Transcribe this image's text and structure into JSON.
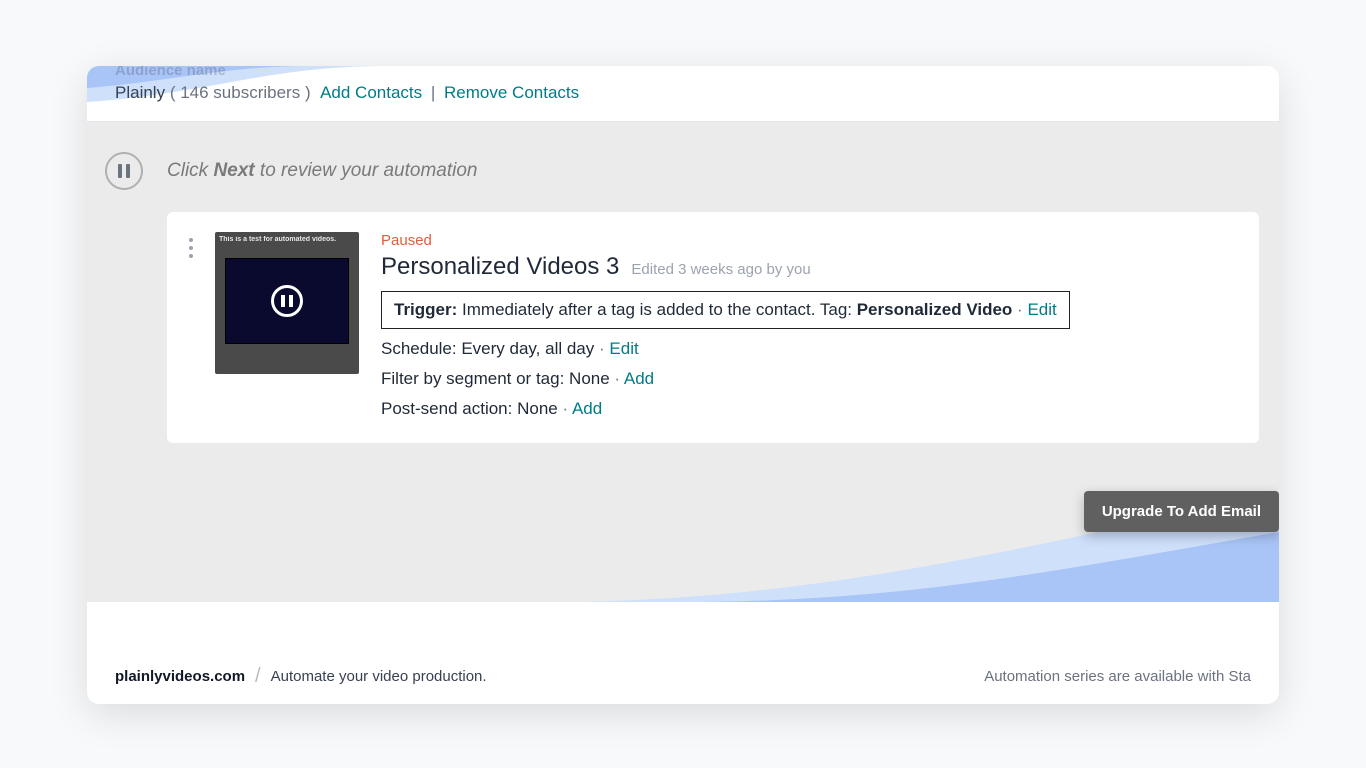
{
  "header": {
    "audience_label": "Audience name",
    "audience_name": "Plainly",
    "subscriber_count": "146 subscribers",
    "add_contacts": "Add Contacts",
    "remove_contacts": "Remove Contacts"
  },
  "instruction": {
    "prefix": "Click ",
    "bold": "Next",
    "suffix": " to review your automation"
  },
  "card": {
    "status": "Paused",
    "title": "Personalized Videos 3",
    "edited_meta": "Edited 3 weeks ago by you",
    "thumb_title": "This is a test for automated videos.",
    "thumb_sub": "",
    "trigger": {
      "label": "Trigger:",
      "text": " Immediately after a tag is added to the contact. Tag: ",
      "tag_bold": "Personalized Video",
      "edit": "Edit"
    },
    "schedule": {
      "label": "Schedule:",
      "value": " Every day, all day",
      "edit": "Edit"
    },
    "filter": {
      "label": "Filter by segment or tag:",
      "value": " None",
      "action": "Add"
    },
    "post_send": {
      "label": "Post-send action:",
      "value": " None",
      "action": "Add"
    }
  },
  "cta": {
    "upgrade": "Upgrade To Add Email"
  },
  "footer": {
    "brand": "plainlyvideos.com",
    "tagline": "Automate your video production.",
    "right_note": "Automation series are available with Sta"
  }
}
